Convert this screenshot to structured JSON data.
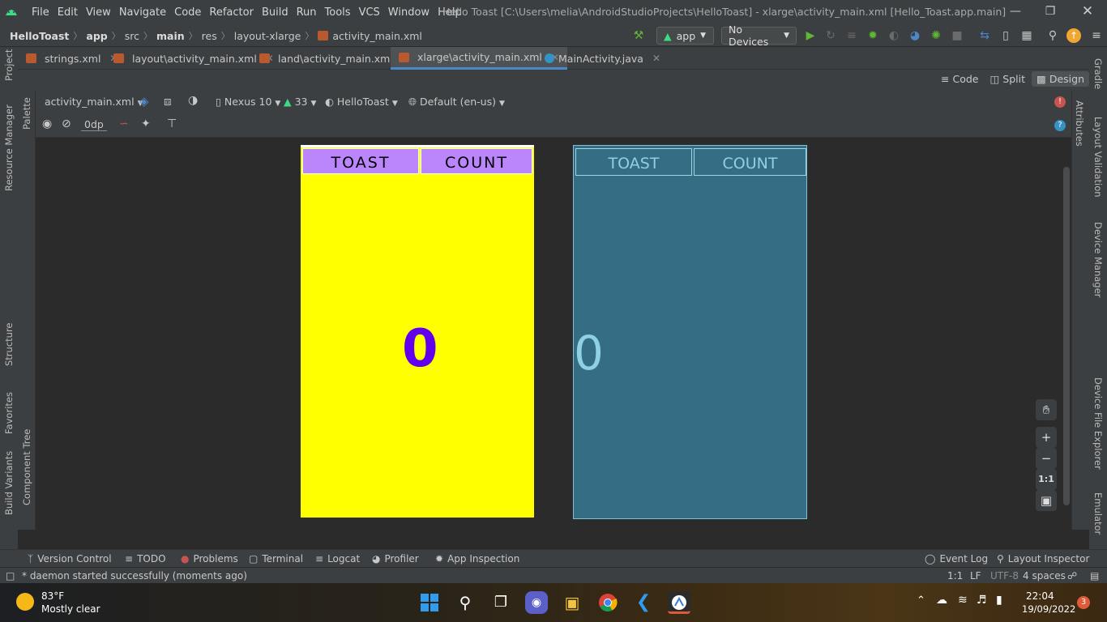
{
  "titlebar": {
    "menu": [
      "File",
      "Edit",
      "View",
      "Navigate",
      "Code",
      "Refactor",
      "Build",
      "Run",
      "Tools",
      "VCS",
      "Window",
      "Help"
    ],
    "title": "Hello Toast [C:\\Users\\melia\\AndroidStudioProjects\\HelloToast] - xlarge\\activity_main.xml [Hello_Toast.app.main]"
  },
  "breadcrumb": [
    "HelloToast",
    "app",
    "src",
    "main",
    "res",
    "layout-xlarge",
    "activity_main.xml"
  ],
  "run": {
    "config": "app",
    "device": "No Devices"
  },
  "tabs": [
    {
      "label": "strings.xml"
    },
    {
      "label": "layout\\activity_main.xml"
    },
    {
      "label": "land\\activity_main.xml"
    },
    {
      "label": "xlarge\\activity_main.xml"
    },
    {
      "label": "MainActivity.java"
    }
  ],
  "modes": {
    "code": "Code",
    "split": "Split",
    "design": "Design"
  },
  "design_toolbar": {
    "file": "activity_main.xml",
    "device": "Nexus 10",
    "api": "33",
    "theme": "HelloToast",
    "locale": "Default (en-us)",
    "margin": "0dp"
  },
  "left_tools": [
    "Project",
    "Resource Manager",
    "Structure",
    "Favorites",
    "Build Variants"
  ],
  "palette_tools": [
    "Palette",
    "Component Tree"
  ],
  "right_tools": [
    "Gradle",
    "Layout Validation",
    "Device Manager",
    "Device File Explorer",
    "Emulator"
  ],
  "attributes_label": "Attributes",
  "preview": {
    "toast": "TOAST",
    "count": "COUNT",
    "value": "0"
  },
  "blueprint": {
    "toast": "TOAST",
    "count": "COUNT",
    "value": "0"
  },
  "zoom": {
    "fit": "1:1"
  },
  "bottom_tools": [
    "Version Control",
    "TODO",
    "Problems",
    "Terminal",
    "Logcat",
    "Profiler",
    "App Inspection"
  ],
  "bottom_right_tools": [
    "Event Log",
    "Layout Inspector"
  ],
  "status": {
    "message": "* daemon started successfully (moments ago)",
    "position": "1:1",
    "line_sep": "LF",
    "encoding": "UTF-8",
    "indent": "4 spaces"
  },
  "taskbar": {
    "weather_temp": "83°F",
    "weather_desc": "Mostly clear",
    "time": "22:04",
    "date": "19/09/2022",
    "notif_count": "3"
  },
  "colors": {
    "accent": "#4a88c7",
    "preview_bg": "#ffff00",
    "button_purple": "#bb86fc",
    "count_purple": "#6200ee",
    "blueprint": "#356d85"
  }
}
